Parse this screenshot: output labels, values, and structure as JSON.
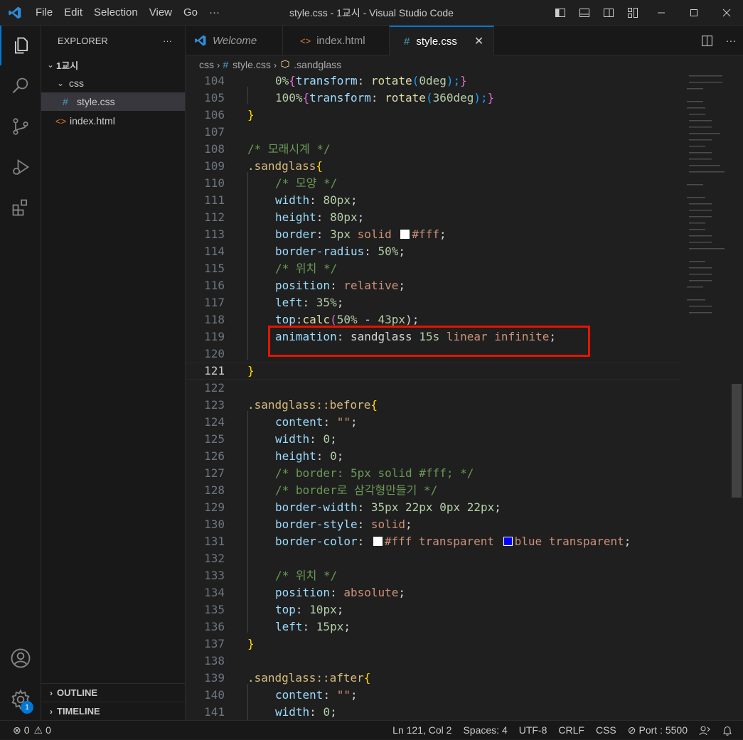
{
  "menu": [
    "File",
    "Edit",
    "Selection",
    "View",
    "Go",
    "···"
  ],
  "window_title": "style.css - 1교시 - Visual Studio Code",
  "explorer": {
    "header": "EXPLORER",
    "more": "···",
    "root": "1교시",
    "folder": "css",
    "file_selected": "style.css",
    "file_other": "index.html",
    "outline": "OUTLINE",
    "timeline": "TIMELINE"
  },
  "tabs": [
    {
      "label": "Welcome"
    },
    {
      "label": "index.html"
    },
    {
      "label": "style.css",
      "close": "✕"
    }
  ],
  "breadcrumb": {
    "folder": "css",
    "file": "style.css",
    "symbol": ".sandglass"
  },
  "accounts_badge": "1",
  "line_numbers": [
    "104",
    "105",
    "106",
    "107",
    "108",
    "109",
    "110",
    "111",
    "112",
    "113",
    "114",
    "115",
    "116",
    "117",
    "118",
    "119",
    "120",
    "121",
    "122",
    "123",
    "124",
    "125",
    "126",
    "127",
    "128",
    "129",
    "130",
    "131",
    "132",
    "133",
    "134",
    "135",
    "136",
    "137",
    "138",
    "139",
    "140",
    "141"
  ],
  "code": {
    "l104": [
      "0%",
      "{",
      "transform",
      ": ",
      "rotate",
      "(",
      "0deg",
      ");",
      "}"
    ],
    "l105": [
      "100%",
      "{",
      "transform",
      ": ",
      "rotate",
      "(",
      "360deg",
      ");",
      "}"
    ],
    "l106": "}",
    "l108": "/* 모래시계 */",
    "l109": [
      ".sandglass",
      "{"
    ],
    "l110": "/* 모양 */",
    "l111": [
      "width",
      ": ",
      "80px",
      ";"
    ],
    "l112": [
      "height",
      ": ",
      "80px",
      ";"
    ],
    "l113": [
      "border",
      ": ",
      "3px",
      " ",
      "solid",
      " ",
      "#fff",
      ";"
    ],
    "l114": [
      "border-radius",
      ": ",
      "50%",
      ";"
    ],
    "l115": "/* 위치 */",
    "l116": [
      "position",
      ": ",
      "relative",
      ";"
    ],
    "l117": [
      "left",
      ": ",
      "35%",
      ";"
    ],
    "l118": [
      "top",
      ":",
      "calc",
      "(",
      "50%",
      " - ",
      "43px",
      ");"
    ],
    "l119": [
      "animation",
      ": ",
      "sandglass",
      " ",
      "15s",
      " ",
      "linear",
      " ",
      "infinite",
      ";"
    ],
    "l121": "}",
    "l123": [
      ".sandglass::before",
      "{"
    ],
    "l124": [
      "content",
      ": ",
      "\"\"",
      ";"
    ],
    "l125": [
      "width",
      ": ",
      "0",
      ";"
    ],
    "l126": [
      "height",
      ": ",
      "0",
      ";"
    ],
    "l127": "/* border: 5px solid #fff; */",
    "l128": "/* border로 삼각형만들기 */",
    "l129": [
      "border-width",
      ": ",
      "35px 22px 0px 22px",
      ";"
    ],
    "l130": [
      "border-style",
      ": ",
      "solid",
      ";"
    ],
    "l131": [
      "border-color",
      ": ",
      "#fff",
      " ",
      "transparent",
      " ",
      "blue",
      " ",
      "transparent",
      ";"
    ],
    "l133": "/* 위치 */",
    "l134": [
      "position",
      ": ",
      "absolute",
      ";"
    ],
    "l135": [
      "top",
      ": ",
      "10px",
      ";"
    ],
    "l136": [
      "left",
      ": ",
      "15px",
      ";"
    ],
    "l137": "}",
    "l139": [
      ".sandglass::after",
      "{"
    ],
    "l140": [
      "content",
      ": ",
      "\"\"",
      ";"
    ],
    "l141": [
      "width",
      ": ",
      "0",
      ";"
    ]
  },
  "status": {
    "errors": "0",
    "warnings": "0",
    "position": "Ln 121, Col 2",
    "spaces": "Spaces: 4",
    "encoding": "UTF-8",
    "eol": "CRLF",
    "language": "CSS",
    "port": "Port : 5500"
  },
  "colors": {
    "accent": "#0078d4",
    "highlight_box": "#e51400",
    "swatch_white": "#ffffff",
    "swatch_blue": "#0000ff"
  }
}
